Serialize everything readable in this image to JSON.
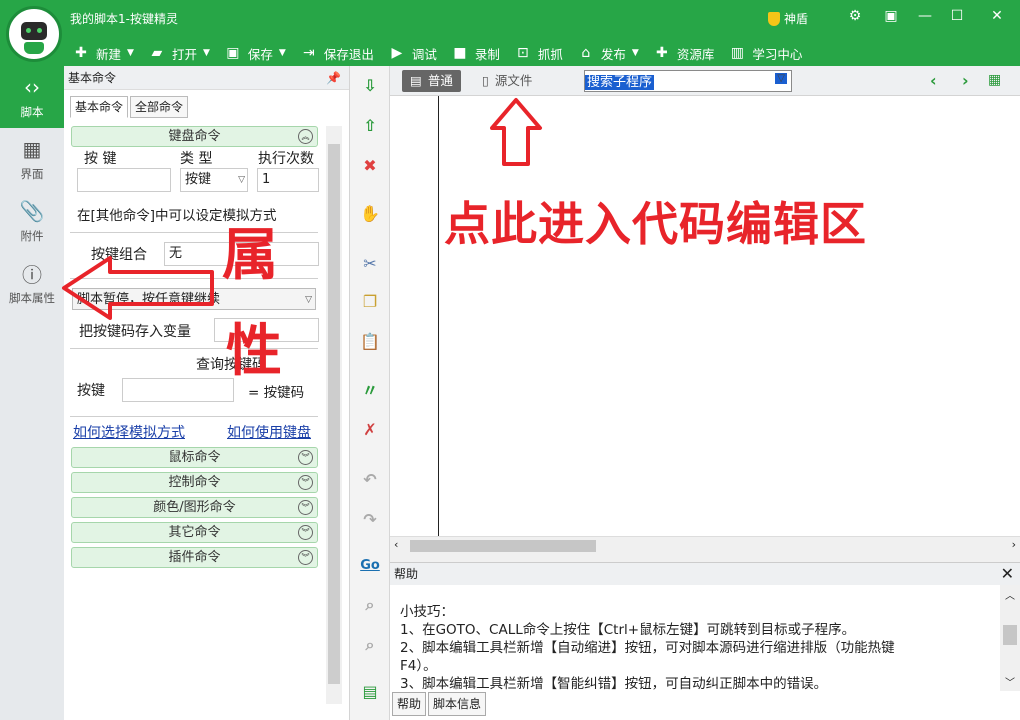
{
  "window": {
    "title": "我的脚本1-按键精灵",
    "shield_label": "神盾"
  },
  "toolbar": [
    {
      "label": "新建",
      "icon": "plus-icon",
      "dropdown": true
    },
    {
      "label": "打开",
      "icon": "folder-icon",
      "dropdown": true
    },
    {
      "label": "保存",
      "icon": "save-icon",
      "dropdown": true
    },
    {
      "label": "保存退出",
      "icon": "save-exit-icon",
      "dropdown": false
    },
    {
      "label": "调试",
      "icon": "play-icon",
      "dropdown": false
    },
    {
      "label": "录制",
      "icon": "camera-icon",
      "dropdown": false
    },
    {
      "label": "抓抓",
      "icon": "grab-icon",
      "dropdown": false
    },
    {
      "label": "发布",
      "icon": "publish-icon",
      "dropdown": true
    },
    {
      "label": "资源库",
      "icon": "resource-icon",
      "dropdown": false
    },
    {
      "label": "学习中心",
      "icon": "book-icon",
      "dropdown": false
    }
  ],
  "leftnav": [
    {
      "label": "脚本",
      "icon": "script-icon",
      "active": true
    },
    {
      "label": "界面",
      "icon": "ui-icon",
      "active": false
    },
    {
      "label": "附件",
      "icon": "attachment-icon",
      "active": false
    },
    {
      "label": "脚本属性",
      "icon": "info-icon",
      "active": false
    }
  ],
  "cmdpanel": {
    "title": "基本命令",
    "tabs": [
      "基本命令",
      "全部命令"
    ],
    "keyboard_section": "键盘命令",
    "col_key": "按 键",
    "col_type": "类 型",
    "col_count": "执行次数",
    "type_value": "按键",
    "count_value": "1",
    "other_note": "在[其他命令]中可以设定模拟方式",
    "combo_label": "按键组合",
    "combo_value": "无",
    "pause_value": "脚本暂停，按任意键继续",
    "store_label": "把按键码存入变量",
    "query_title": "查询按键码",
    "query_key_label": "按键",
    "query_eq_label": "= 按键码",
    "link_simulate": "如何选择模拟方式",
    "link_keyboard": "如何使用键盘",
    "sections": [
      "鼠标命令",
      "控制命令",
      "颜色/图形命令",
      "其它命令",
      "插件命令"
    ]
  },
  "editor": {
    "tab_normal": "普通",
    "tab_source": "源文件",
    "search_value": "搜索子程序"
  },
  "help": {
    "title": "帮助",
    "lines": [
      "小技巧：",
      "1、在GOTO、CALL命令上按住【Ctrl+鼠标左键】可跳转到目标或子程序。",
      "2、脚本编辑工具栏新增【自动缩进】按钮，可对脚本源码进行缩进排版（功能热键",
      "F4）。",
      "3、脚本编辑工具栏新增【智能纠错】按钮，可自动纠正脚本中的错误。"
    ],
    "tabs": [
      "帮助",
      "脚本信息"
    ]
  },
  "annotations": {
    "editor_hint": "点此进入代码编辑区",
    "prop_char1": "属",
    "prop_char2": "性"
  },
  "colors": {
    "brand": "#27a647",
    "annotation": "#e8242a"
  }
}
